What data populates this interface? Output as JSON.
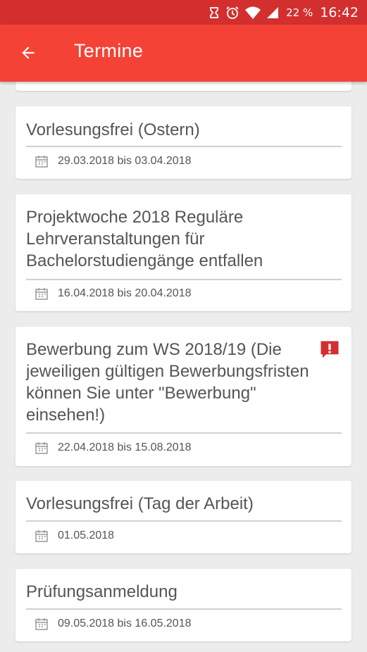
{
  "status_bar": {
    "battery": "22 %",
    "time": "16:42",
    "icons": [
      "sync-icon",
      "alarm-icon",
      "wifi-icon",
      "signal-icon"
    ]
  },
  "app_bar": {
    "title": "Termine",
    "back_icon": "arrow-back-icon",
    "color": "#f44336",
    "status_color": "#d32f2f"
  },
  "events": [
    {
      "title": "",
      "date": ""
    },
    {
      "title": "Vorlesungsfrei (Ostern)",
      "date": "29.03.2018 bis 03.04.2018"
    },
    {
      "title": "Projektwoche 2018 Reguläre Lehrveranstaltungen für Bachelorstudiengänge entfallen",
      "date": "16.04.2018 bis 20.04.2018"
    },
    {
      "title": "Bewerbung zum WS 2018/19 (Die jeweiligen gültigen Bewerbungsfristen können Sie unter \"Bewerbung\" einsehen!)",
      "date": "22.04.2018 bis 15.08.2018",
      "important": true
    },
    {
      "title": "Vorlesungsfrei (Tag der Arbeit)",
      "date": "01.05.2018"
    },
    {
      "title": "Prüfungsanmeldung",
      "date": "09.05.2018 bis 16.05.2018"
    }
  ],
  "alert_color": "#d32f2f"
}
